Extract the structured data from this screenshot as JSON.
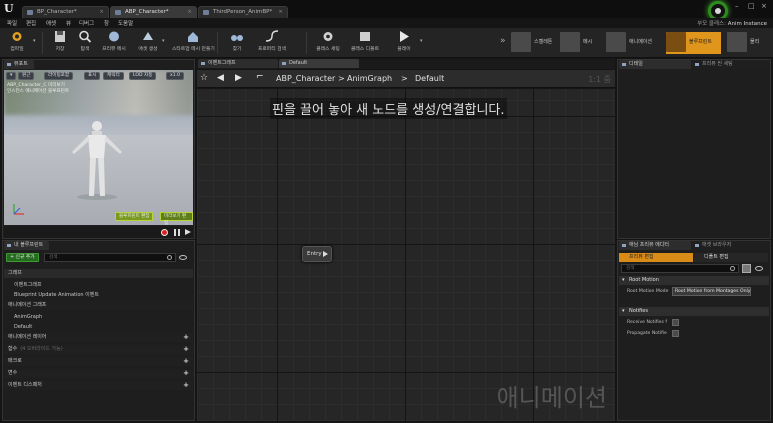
{
  "title_bar": {
    "tabs": [
      {
        "label": "BP_Character*",
        "active": false
      },
      {
        "label": "ABP_Character*",
        "active": true
      },
      {
        "label": "ThirdPerson_AnimBP*",
        "active": false
      }
    ]
  },
  "menubar": {
    "items": [
      "파일",
      "편집",
      "애셋",
      "뷰",
      "디버그",
      "창",
      "도움말"
    ],
    "parent_class_label": "부모 클래스:",
    "parent_class_value": "Anim Instance"
  },
  "toolbar": {
    "buttons": [
      "컴파일",
      "저장",
      "탐색",
      "프리뷰 메시",
      "애셋 생성",
      "스타트업 메시 만들기",
      "찾기",
      "클래스 세팅",
      "클래스 디폴트",
      "플레이"
    ],
    "modes": [
      "스켈레톤",
      "메시",
      "애니메이션",
      "블루프린트",
      "물리"
    ]
  },
  "viewport": {
    "tab_label": "뷰포트",
    "buttons": [
      "원근",
      "라이팅포함",
      "표시",
      "캐릭터",
      "LOD 자동",
      "x1.0"
    ],
    "info_lines": [
      "ABP_Character_C 미리보기",
      "인스턴스 애니메이션 블루프린트"
    ],
    "status_left": "블루프린트 편집",
    "status_right": "미리보기 편집"
  },
  "my_blueprint": {
    "tab_label": "내 블루프린트",
    "add_new": "+ 신규 추가",
    "search_placeholder": "검색",
    "rows": [
      {
        "label": "그래프",
        "kind": "cat",
        "plus": false
      },
      {
        "label": "이벤트그래프",
        "kind": "item",
        "plus": false
      },
      {
        "label": "Blueprint Update Animation 이벤트",
        "kind": "item",
        "plus": false
      },
      {
        "label": "애니메이션 그래프",
        "kind": "sub",
        "plus": false
      },
      {
        "label": "AnimGraph",
        "kind": "item",
        "plus": false
      },
      {
        "label": "Default",
        "kind": "item",
        "plus": false
      },
      {
        "label": "애니메이션 레이어",
        "kind": "sub",
        "plus": true
      },
      {
        "label": "함수",
        "kind": "sub",
        "plus": true,
        "dim": "(4 오버라이드 가능)"
      },
      {
        "label": "매크로",
        "kind": "sub",
        "plus": true
      },
      {
        "label": "변수",
        "kind": "sub",
        "plus": true
      },
      {
        "label": "이벤트 디스패처",
        "kind": "sub",
        "plus": true
      }
    ]
  },
  "graph": {
    "tabs": [
      "이벤트그래프",
      "Default"
    ],
    "breadcrumb": [
      "ABP_Character",
      ">",
      "AnimGraph",
      ">",
      "Default"
    ],
    "zoom": "1:1 줌",
    "hint": "핀을 끌어 놓아 새 노드를 생성/연결합니다.",
    "entry_node": "Entry",
    "watermark": "애니메이션"
  },
  "details": {
    "tabs": [
      "디테일",
      "프리뷰 씬 세팅"
    ]
  },
  "preview_editor": {
    "tabs": [
      "애님 프리뷰 에디터",
      "애셋 브라우저"
    ],
    "sub_tabs": [
      "프리뷰 편집",
      "디폴트 편집"
    ],
    "search_placeholder": "검색",
    "root_motion": {
      "header": "Root Motion",
      "mode_label": "Root Motion Mode",
      "mode_value": "Root Motion from Montages Only"
    },
    "notifies": {
      "header": "Notifies",
      "receive_label": "Receive Notifies f",
      "propagate_label": "Propagate Notifie"
    }
  }
}
